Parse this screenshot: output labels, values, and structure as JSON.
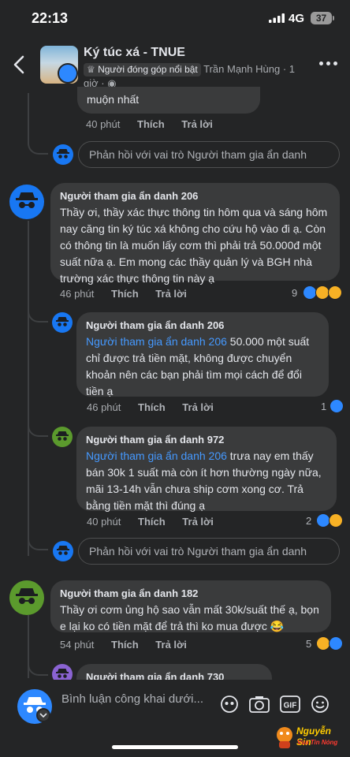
{
  "status_bar": {
    "time": "22:13",
    "network": "4G",
    "battery": "37"
  },
  "header": {
    "group_name": "Ký túc xá - TNUE",
    "contributor_badge": "Người đóng góp nổi bật",
    "author": "Trần Mạnh Hùng",
    "time": "1 giờ"
  },
  "top_fragment": {
    "text": "muộn nhất",
    "time": "40 phút",
    "like": "Thích",
    "reply": "Trả lời"
  },
  "reply_prompt": "Phản hồi với vai trò Người tham gia ẩn danh",
  "comments": [
    {
      "author": "Người tham gia ẩn danh 206",
      "text": "Thầy ơi, thầy xác thực thông tin hôm qua và sáng hôm nay căng tin ký túc xá không cho cứu hộ vào đi ạ. Còn có thông tin là muốn lấy cơm thì phải trả 50.000đ một suất nữa ạ. Em mong các thầy quản lý và BGH nhà trường xác thực thông tin này ạ",
      "time": "46 phút",
      "like": "Thích",
      "reply": "Trả lời",
      "reactions": "9",
      "avatar_color": "#1877f2"
    },
    {
      "author": "Người tham gia ẩn danh 206",
      "mention": "Người tham gia ẩn danh 206",
      "text": " 50.000 một suất chỉ được trả tiền mặt, không được chuyển khoản nên các bạn phải tìm mọi cách để đổi tiền ạ",
      "time": "46 phút",
      "like": "Thích",
      "reply": "Trả lời",
      "reactions": "1",
      "avatar_color": "#1877f2"
    },
    {
      "author": "Người tham gia ẩn danh 972",
      "mention": "Người tham gia ẩn danh 206",
      "text": " trưa nay em thấy bán 30k 1 suất mà còn ít hơn thường ngày nữa, mãi 13-14h vẫn chưa ship cơm xong cơ. Trả bằng tiền mặt thì đúng ạ",
      "time": "40 phút",
      "like": "Thích",
      "reply": "Trả lời",
      "reactions": "2",
      "avatar_color": "#5b9a2d"
    },
    {
      "author": "Người tham gia ẩn danh 182",
      "text": "Thầy ơi cơm ủng hộ sao vẫn mất 30k/suất thế ạ, bọn e lại ko có tiền mặt để trả thì ko mua được 😂",
      "time": "54 phút",
      "like": "Thích",
      "reply": "Trả lời",
      "reactions": "5",
      "avatar_color": "#5b9a2d"
    },
    {
      "author": "Người tham gia ẩn danh 730",
      "avatar_color": "#8a63d2"
    }
  ],
  "composer": {
    "placeholder": "Bình luận công khai dưới..."
  },
  "watermark": {
    "name": "Nguyễn Sin",
    "tagline": "Vua Tin Nóng"
  },
  "colors": {
    "accent": "#2d88ff",
    "background": "#242526",
    "bubble": "#3a3b3c"
  }
}
